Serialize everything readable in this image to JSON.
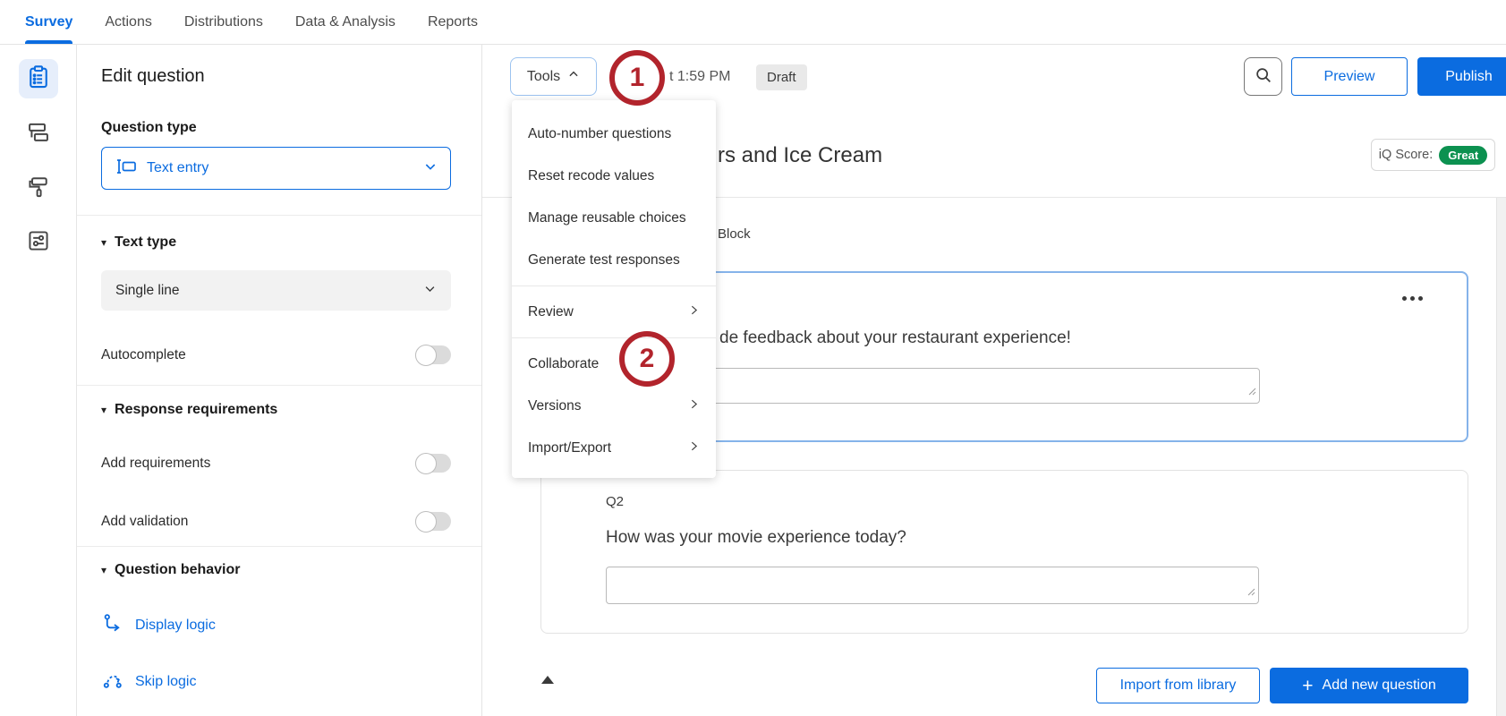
{
  "nav": {
    "tabs": [
      {
        "label": "Survey"
      },
      {
        "label": "Actions"
      },
      {
        "label": "Distributions"
      },
      {
        "label": "Data & Analysis"
      },
      {
        "label": "Reports"
      }
    ]
  },
  "panel": {
    "title": "Edit question",
    "question_type_label": "Question type",
    "question_type_value": "Text entry",
    "text_type": {
      "header": "Text type",
      "value": "Single line",
      "autocomplete": "Autocomplete"
    },
    "requirements": {
      "header": "Response requirements",
      "add_requirements": "Add requirements",
      "add_validation": "Add validation"
    },
    "behavior": {
      "header": "Question behavior",
      "display_logic": "Display logic",
      "skip_logic": "Skip logic"
    }
  },
  "toolbar": {
    "tools": "Tools",
    "saved_fragment": "t 1:59 PM",
    "draft": "Draft",
    "preview": "Preview",
    "publish": "Publish"
  },
  "menu": {
    "items": [
      {
        "label": "Auto-number questions",
        "submenu": false
      },
      {
        "label": "Reset recode values",
        "submenu": false
      },
      {
        "label": "Manage reusable choices",
        "submenu": false
      },
      {
        "label": "Generate test responses",
        "submenu": false
      },
      {
        "label": "Review",
        "submenu": true
      },
      {
        "label": "Collaborate",
        "submenu": false
      },
      {
        "label": "Versions",
        "submenu": true
      },
      {
        "label": "Import/Export",
        "submenu": true
      }
    ]
  },
  "annotations": {
    "one": "1",
    "two": "2"
  },
  "content": {
    "title_fragment": "rs and Ice Cream",
    "block_fragment": "Block",
    "iq_label": "iQ Score:",
    "iq_value": "Great",
    "q1_fragment": "de feedback about your restaurant experience!",
    "q2_number": "Q2",
    "q2_text": "How was your movie experience today?",
    "import_library": "Import from library",
    "add_question": "Add new question"
  },
  "colors": {
    "accent_blue": "#0b6ce0",
    "annotation_red": "#b2242c",
    "iq_green": "#0c9150",
    "draft_bg": "#e9e9e9"
  }
}
